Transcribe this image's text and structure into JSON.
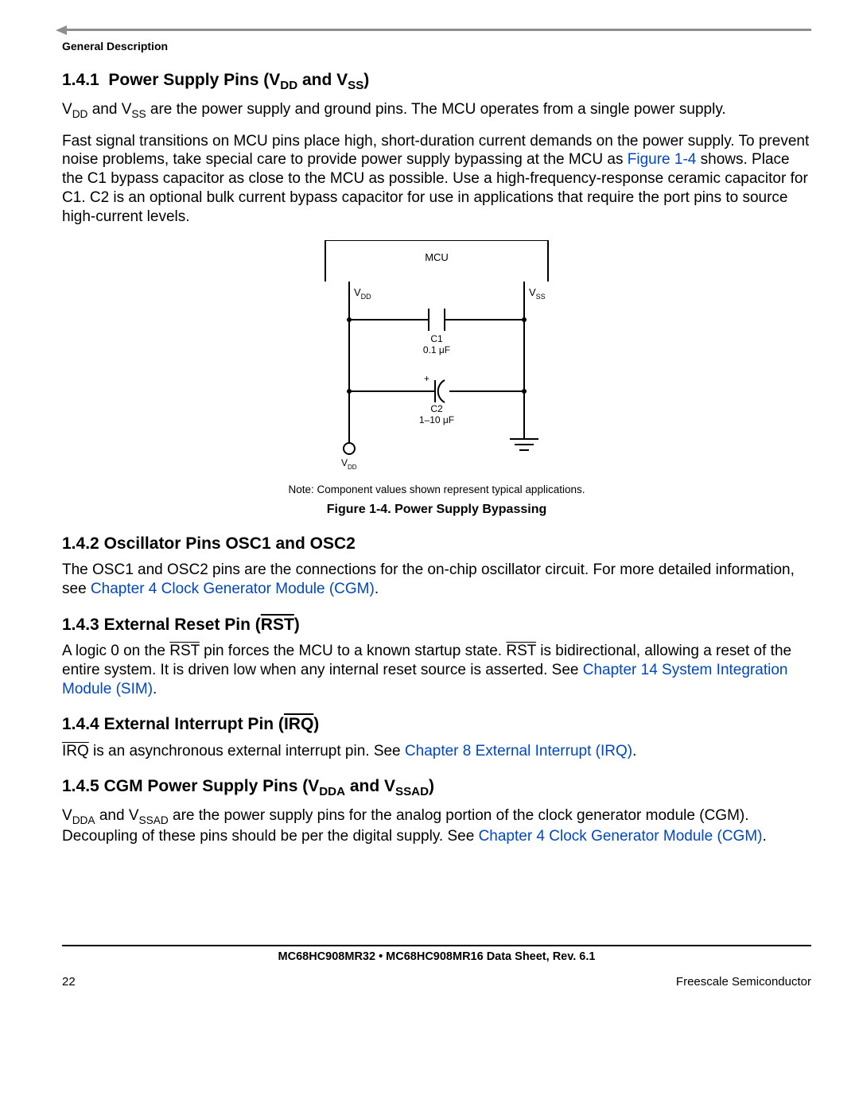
{
  "header": {
    "section_label": "General Description"
  },
  "sections": {
    "s141": {
      "num": "1.4.1",
      "title_pre": "Power Supply Pins (V",
      "title_sub1": "DD",
      "title_mid": " and V",
      "title_sub2": "SS",
      "title_post": ")",
      "p1_a": "V",
      "p1_sub1": "DD",
      "p1_b": " and V",
      "p1_sub2": "SS",
      "p1_c": " are the power supply and ground pins. The MCU operates from a single power supply.",
      "p2_a": "Fast signal transitions on MCU pins place high, short-duration current demands on the power supply. To prevent noise problems, take special care to provide power supply bypassing at the MCU as ",
      "p2_link": "Figure 1-4",
      "p2_b": " shows. Place the C1 bypass capacitor as close to the MCU as possible. Use a high-frequency-response ceramic capacitor for C1. C2 is an optional bulk current bypass capacitor for use in applications that require the port pins to source high-current levels."
    },
    "figure": {
      "mcu": "MCU",
      "vdd": "V",
      "vdd_sub": "DD",
      "vss": "V",
      "vss_sub": "SS",
      "c1": "C1",
      "c1v": "0.1 μF",
      "plus": "+",
      "c2": "C2",
      "c2v": "1–10 μF",
      "vdd2": "V",
      "vdd2_sub": "DD",
      "note": "Note: Component values shown represent typical applications.",
      "caption": "Figure 1-4. Power Supply Bypassing"
    },
    "s142": {
      "num": "1.4.2",
      "title": "Oscillator Pins OSC1 and OSC2",
      "p_a": "The OSC1 and OSC2 pins are the connections for the on-chip oscillator circuit. For more detailed information, see ",
      "link": "Chapter 4 Clock Generator Module (CGM)",
      "p_b": "."
    },
    "s143": {
      "num": "1.4.3",
      "title_pre": "External Reset Pin (",
      "title_ovl": "RST",
      "title_post": ")",
      "p_a": "A logic 0 on the ",
      "p_ovl1": "RST",
      "p_b": " pin forces the MCU to a known startup state. ",
      "p_ovl2": "RST",
      "p_c": " is bidirectional, allowing a reset of the entire system. It is driven low when any internal reset source is asserted. See ",
      "link": "Chapter 14 System Integration Module (SIM)",
      "p_d": "."
    },
    "s144": {
      "num": "1.4.4",
      "title_pre": "External Interrupt Pin (",
      "title_ovl": "IRQ",
      "title_post": ")",
      "p_ovl": "IRQ",
      "p_a": " is an asynchronous external interrupt pin. See ",
      "link": "Chapter 8 External Interrupt (IRQ)",
      "p_b": "."
    },
    "s145": {
      "num": "1.4.5",
      "title_pre": "CGM Power Supply Pins (V",
      "title_sub1": "DDA",
      "title_mid": " and V",
      "title_sub2": "SSAD",
      "title_post": ")",
      "p_a": "V",
      "p_sub1": "DDA",
      "p_b": " and V",
      "p_sub2": "SSAD",
      "p_c": " are the power supply pins for the analog portion of the clock generator module (CGM). Decoupling of these pins should be per the digital supply. See ",
      "link": "Chapter 4 Clock Generator Module (CGM)",
      "p_d": "."
    }
  },
  "footer": {
    "doc": "MC68HC908MR32 • MC68HC908MR16 Data Sheet, Rev. 6.1",
    "page": "22",
    "company": "Freescale Semiconductor"
  }
}
